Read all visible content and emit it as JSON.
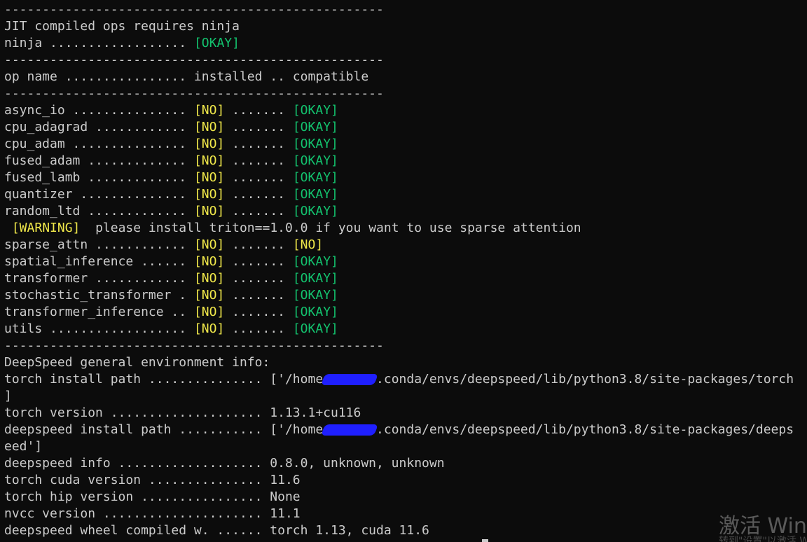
{
  "terminal": {
    "lines": [
      [
        {
          "t": "--------------------------------------------------",
          "c": "plain"
        }
      ],
      [
        {
          "t": "JIT compiled ops requires ninja",
          "c": "plain"
        }
      ],
      [
        {
          "t": "ninja .................. ",
          "c": "plain"
        },
        {
          "t": "[OKAY]",
          "c": "green"
        }
      ],
      [
        {
          "t": "--------------------------------------------------",
          "c": "plain"
        }
      ],
      [
        {
          "t": "op name ................ installed .. compatible",
          "c": "plain"
        }
      ],
      [
        {
          "t": "--------------------------------------------------",
          "c": "plain"
        }
      ],
      [
        {
          "t": "async_io ............... ",
          "c": "plain"
        },
        {
          "t": "[NO]",
          "c": "yellow"
        },
        {
          "t": " ....... ",
          "c": "plain"
        },
        {
          "t": "[OKAY]",
          "c": "green"
        }
      ],
      [
        {
          "t": "cpu_adagrad ............ ",
          "c": "plain"
        },
        {
          "t": "[NO]",
          "c": "yellow"
        },
        {
          "t": " ....... ",
          "c": "plain"
        },
        {
          "t": "[OKAY]",
          "c": "green"
        }
      ],
      [
        {
          "t": "cpu_adam ............... ",
          "c": "plain"
        },
        {
          "t": "[NO]",
          "c": "yellow"
        },
        {
          "t": " ....... ",
          "c": "plain"
        },
        {
          "t": "[OKAY]",
          "c": "green"
        }
      ],
      [
        {
          "t": "fused_adam ............. ",
          "c": "plain"
        },
        {
          "t": "[NO]",
          "c": "yellow"
        },
        {
          "t": " ....... ",
          "c": "plain"
        },
        {
          "t": "[OKAY]",
          "c": "green"
        }
      ],
      [
        {
          "t": "fused_lamb ............. ",
          "c": "plain"
        },
        {
          "t": "[NO]",
          "c": "yellow"
        },
        {
          "t": " ....... ",
          "c": "plain"
        },
        {
          "t": "[OKAY]",
          "c": "green"
        }
      ],
      [
        {
          "t": "quantizer .............. ",
          "c": "plain"
        },
        {
          "t": "[NO]",
          "c": "yellow"
        },
        {
          "t": " ....... ",
          "c": "plain"
        },
        {
          "t": "[OKAY]",
          "c": "green"
        }
      ],
      [
        {
          "t": "random_ltd ............. ",
          "c": "plain"
        },
        {
          "t": "[NO]",
          "c": "yellow"
        },
        {
          "t": " ....... ",
          "c": "plain"
        },
        {
          "t": "[OKAY]",
          "c": "green"
        }
      ],
      [
        {
          "t": " ",
          "c": "plain"
        },
        {
          "t": "[WARNING]",
          "c": "yellow"
        },
        {
          "t": "  please install triton==1.0.0 if you want to use sparse attention",
          "c": "plain"
        }
      ],
      [
        {
          "t": "sparse_attn ............ ",
          "c": "plain"
        },
        {
          "t": "[NO]",
          "c": "yellow"
        },
        {
          "t": " ....... ",
          "c": "plain"
        },
        {
          "t": "[NO]",
          "c": "yellow"
        }
      ],
      [
        {
          "t": "spatial_inference ...... ",
          "c": "plain"
        },
        {
          "t": "[NO]",
          "c": "yellow"
        },
        {
          "t": " ....... ",
          "c": "plain"
        },
        {
          "t": "[OKAY]",
          "c": "green"
        }
      ],
      [
        {
          "t": "transformer ............ ",
          "c": "plain"
        },
        {
          "t": "[NO]",
          "c": "yellow"
        },
        {
          "t": " ....... ",
          "c": "plain"
        },
        {
          "t": "[OKAY]",
          "c": "green"
        }
      ],
      [
        {
          "t": "stochastic_transformer . ",
          "c": "plain"
        },
        {
          "t": "[NO]",
          "c": "yellow"
        },
        {
          "t": " ....... ",
          "c": "plain"
        },
        {
          "t": "[OKAY]",
          "c": "green"
        }
      ],
      [
        {
          "t": "transformer_inference .. ",
          "c": "plain"
        },
        {
          "t": "[NO]",
          "c": "yellow"
        },
        {
          "t": " ....... ",
          "c": "plain"
        },
        {
          "t": "[OKAY]",
          "c": "green"
        }
      ],
      [
        {
          "t": "utils .................. ",
          "c": "plain"
        },
        {
          "t": "[NO]",
          "c": "yellow"
        },
        {
          "t": " ....... ",
          "c": "plain"
        },
        {
          "t": "[OKAY]",
          "c": "green"
        }
      ],
      [
        {
          "t": "--------------------------------------------------",
          "c": "plain"
        }
      ],
      [
        {
          "t": "DeepSpeed general environment info:",
          "c": "plain"
        }
      ],
      [
        {
          "t": "torch install path ............... ['/home",
          "c": "plain"
        },
        {
          "t": "xxxxxxx",
          "c": "redact"
        },
        {
          "t": ".conda/envs/deepspeed/lib/python3.8/site-packages/torch",
          "c": "plain"
        }
      ],
      [
        {
          "t": "]",
          "c": "plain"
        }
      ],
      [
        {
          "t": "torch version .................... 1.13.1+cu116",
          "c": "plain"
        }
      ],
      [
        {
          "t": "deepspeed install path ........... ['/home",
          "c": "plain"
        },
        {
          "t": "xxxxxxx",
          "c": "redact"
        },
        {
          "t": ".conda/envs/deepspeed/lib/python3.8/site-packages/deeps",
          "c": "plain"
        }
      ],
      [
        {
          "t": "eed']",
          "c": "plain"
        }
      ],
      [
        {
          "t": "deepspeed info ................... 0.8.0, unknown, unknown",
          "c": "plain"
        }
      ],
      [
        {
          "t": "torch cuda version ............... 11.6",
          "c": "plain"
        }
      ],
      [
        {
          "t": "torch hip version ................ None",
          "c": "plain"
        }
      ],
      [
        {
          "t": "nvcc version ..................... 11.1",
          "c": "plain"
        }
      ],
      [
        {
          "t": "deepspeed wheel compiled w. ...... torch 1.13, cuda 11.6",
          "c": "plain"
        }
      ]
    ]
  },
  "watermark": {
    "title": "激活 Windows",
    "subtitle": "转到\"设置\"以激活 Windows。"
  }
}
